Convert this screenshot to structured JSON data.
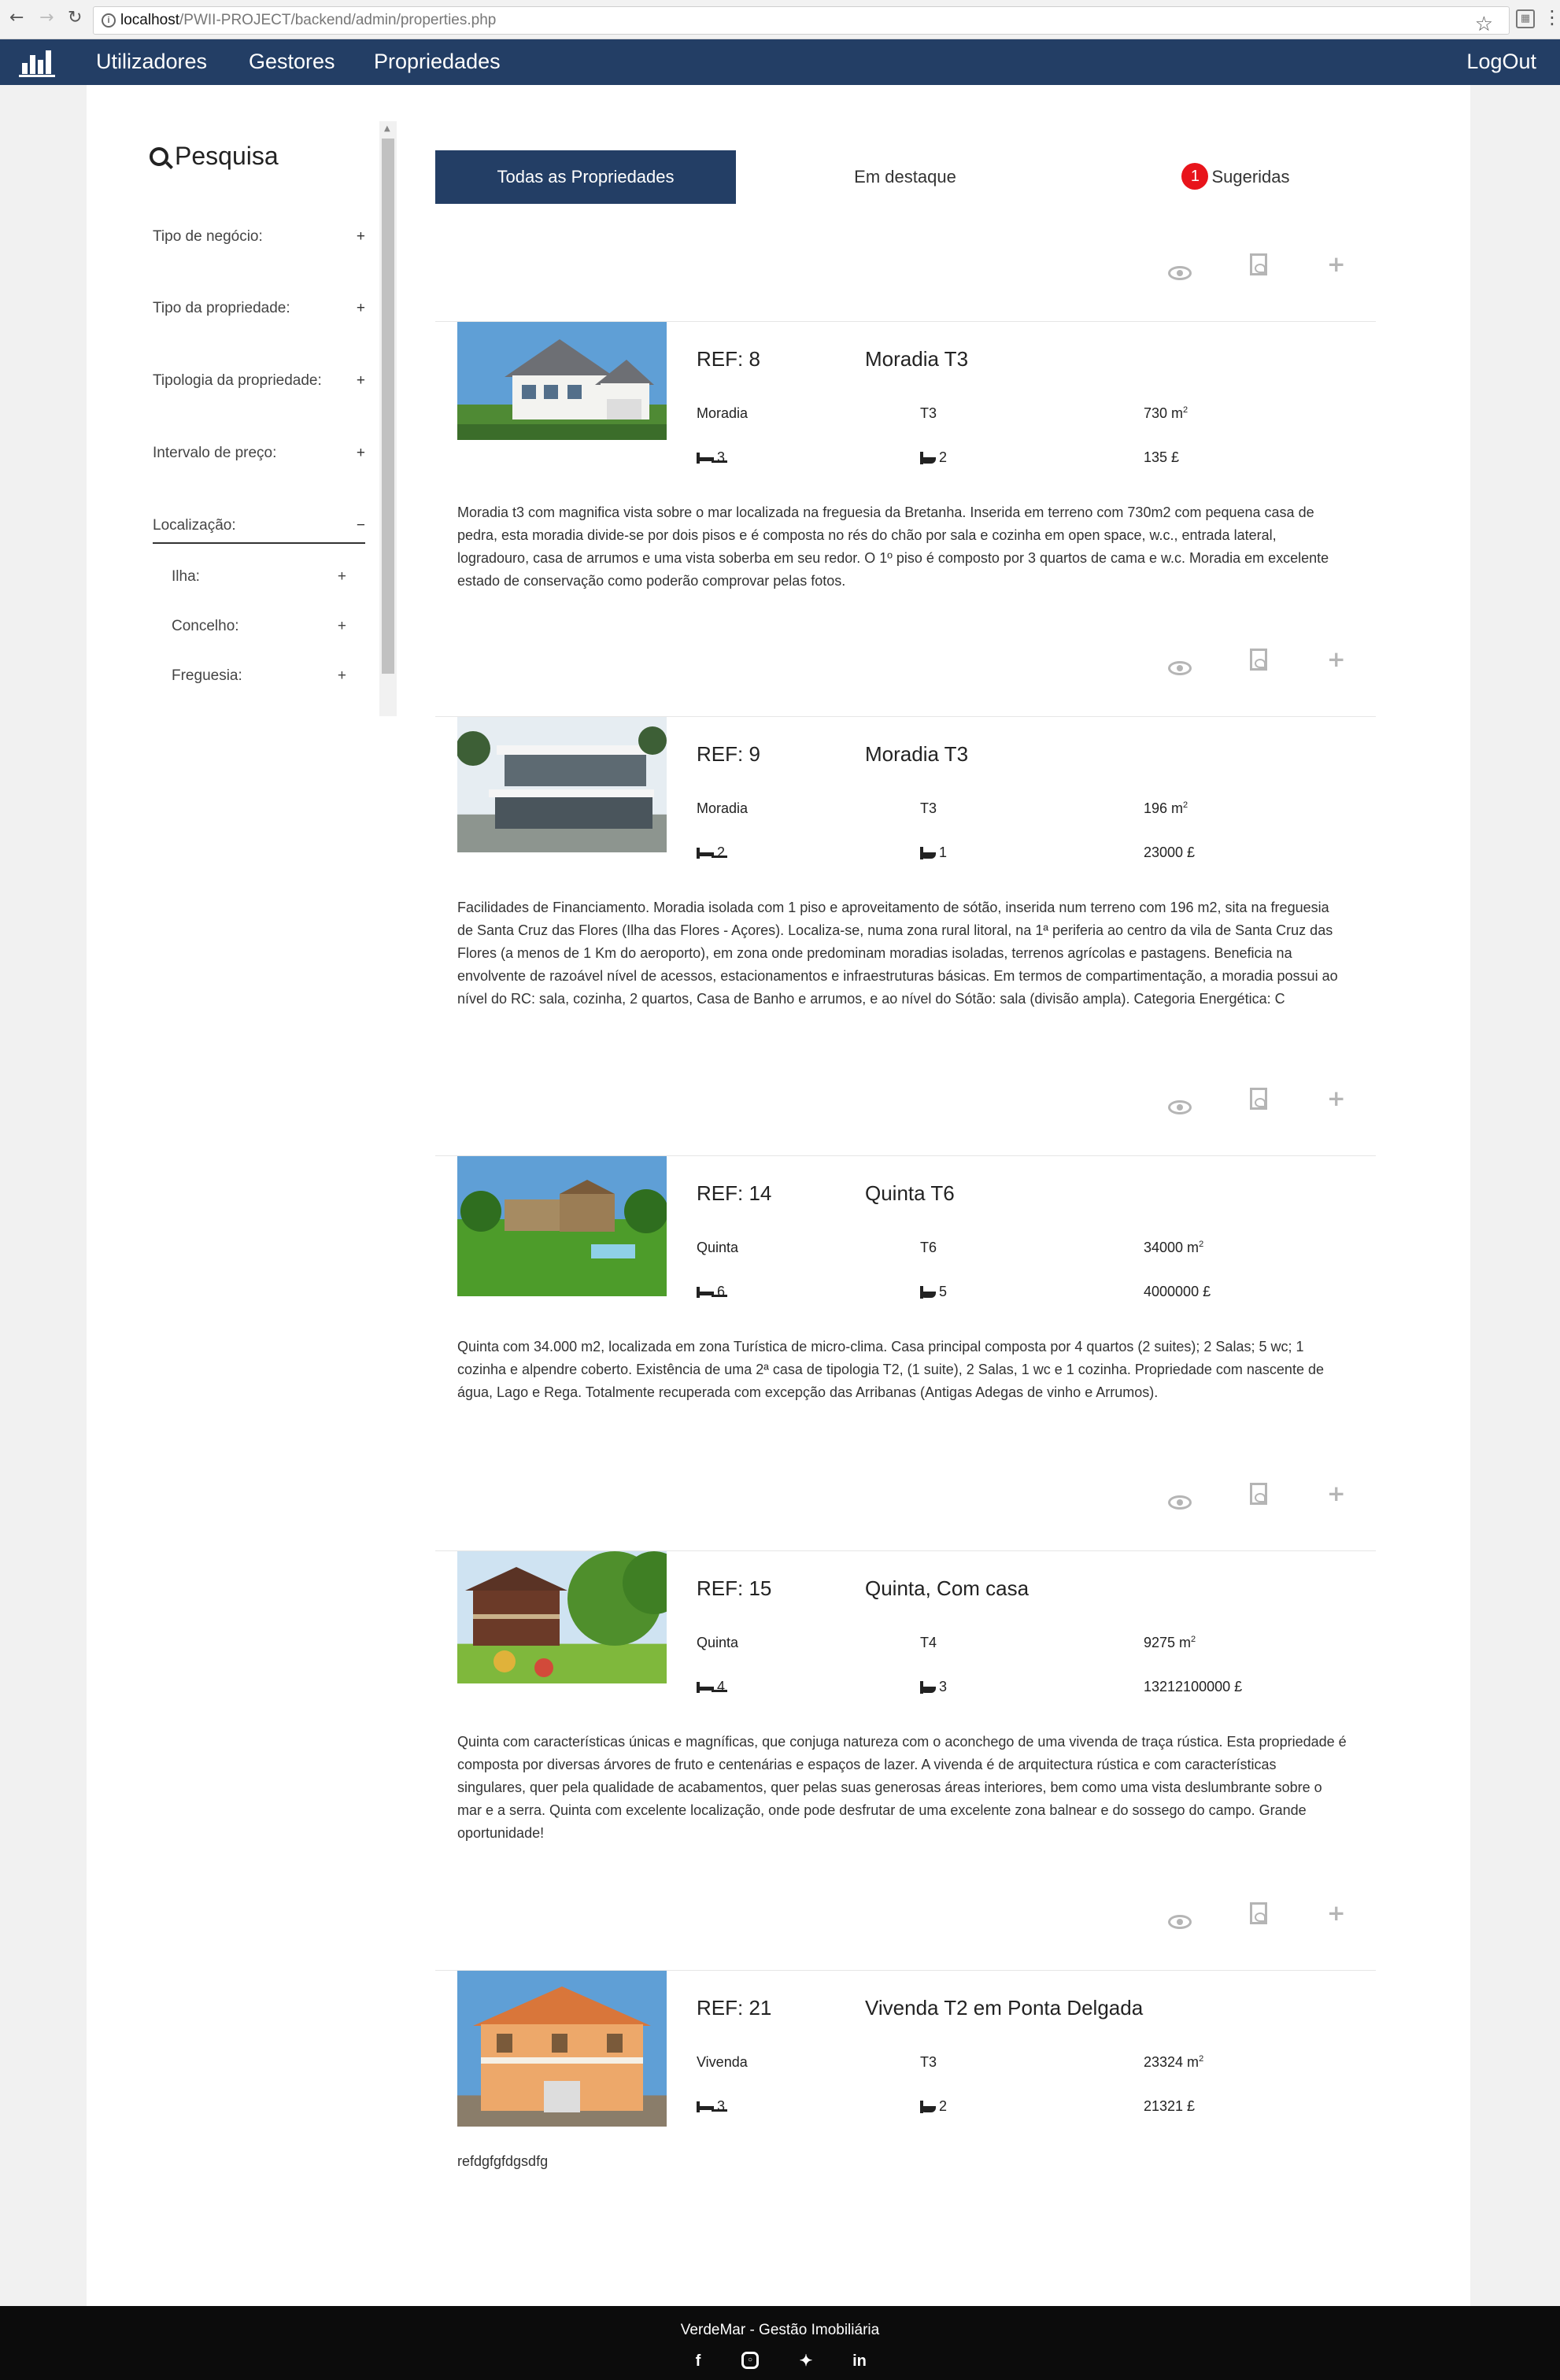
{
  "browser": {
    "url_host": "localhost",
    "url_path": "/PWII-PROJECT/backend/admin/properties.php"
  },
  "navbar": {
    "links": [
      "Utilizadores",
      "Gestores",
      "Propriedades"
    ],
    "logout": "LogOut"
  },
  "sidebar": {
    "title": "Pesquisa",
    "filters": [
      {
        "label": "Tipo de negócio:",
        "sign": "+"
      },
      {
        "label": "Tipo da propriedade:",
        "sign": "+"
      },
      {
        "label": "Tipologia da propriedade:",
        "sign": "+"
      },
      {
        "label": "Intervalo de preço:",
        "sign": "+"
      },
      {
        "label": "Localização:",
        "sign": "−"
      }
    ],
    "location_sub": [
      {
        "label": "Ilha:",
        "sign": "+"
      },
      {
        "label": "Concelho:",
        "sign": "+"
      },
      {
        "label": "Freguesia:",
        "sign": "+"
      }
    ]
  },
  "tabs": {
    "all": "Todas as Propriedades",
    "featured": "Em destaque",
    "suggested": "Sugeridas",
    "suggested_count": "1"
  },
  "properties": [
    {
      "ref": "REF: 8",
      "name": "Moradia T3",
      "type": "Moradia",
      "typology": "T3",
      "area": "730 m",
      "beds": "3",
      "baths": "2",
      "price": "135 £",
      "photo": "house-white",
      "description": "Moradia t3 com magnifica vista sobre o mar localizada na freguesia da Bretanha. Inserida em terreno com 730m2 com pequena casa de pedra, esta moradia divide-se por dois pisos e é composta no rés do chão por sala e cozinha em open space, w.c., entrada lateral, logradouro, casa de arrumos e uma vista soberba em seu redor. O 1º piso é composto por 3 quartos de cama e w.c. Moradia em excelente estado de conservação como poderão comprovar pelas fotos."
    },
    {
      "ref": "REF: 9",
      "name": "Moradia T3",
      "type": "Moradia",
      "typology": "T3",
      "area": "196 m",
      "beds": "2",
      "baths": "1",
      "price": "23000 £",
      "photo": "house-modern",
      "description": "Facilidades de Financiamento. Moradia isolada com 1 piso e aproveitamento de sótão, inserida num terreno com 196 m2, sita na freguesia de Santa Cruz das Flores (Ilha das Flores - Açores). Localiza-se, numa zona rural litoral, na 1ª periferia ao centro da vila de Santa Cruz das Flores (a menos de 1 Km do aeroporto), em zona onde predominam moradias isoladas, terrenos agrícolas e pastagens. Beneficia na envolvente de razoável nível de acessos, estacionamentos e infraestruturas básicas. Em termos de compartimentação, a moradia possui ao nível do RC: sala, cozinha, 2 quartos, Casa de Banho e arrumos, e ao nível do Sótão: sala (divisão ampla). Categoria Energética: C"
    },
    {
      "ref": "REF: 14",
      "name": "Quinta T6",
      "type": "Quinta",
      "typology": "T6",
      "area": "34000 m",
      "beds": "6",
      "baths": "5",
      "price": "4000000 £",
      "photo": "farm-pool",
      "description": "Quinta com 34.000 m2, localizada em zona Turística de micro-clima. Casa principal composta por 4 quartos (2 suites); 2 Salas; 5 wc; 1 cozinha e alpendre coberto. Existência de uma 2ª casa de tipologia T2, (1 suite), 2 Salas, 1 wc e 1 cozinha. Propriedade com nascente de água, Lago e Rega. Totalmente recuperada com excepção das Arribanas (Antigas Adegas de vinho e Arrumos)."
    },
    {
      "ref": "REF: 15",
      "name": "Quinta, Com casa",
      "type": "Quinta",
      "typology": "T4",
      "area": "9275 m",
      "beds": "4",
      "baths": "3",
      "price": "13212100000 £",
      "photo": "farm-wood",
      "description": "Quinta com características únicas e magníficas, que conjuga natureza com o aconchego de uma vivenda de traça rústica. Esta propriedade é composta por diversas árvores de fruto e centenárias e espaços de lazer. A vivenda é de arquitectura rústica e com características singulares, quer pela qualidade de acabamentos, quer pelas suas generosas áreas interiores, bem como uma vista deslumbrante sobre o mar e a serra. Quinta com excelente localização, onde pode desfrutar de uma excelente zona balnear e do sossego do campo. Grande oportunidade!"
    },
    {
      "ref": "REF: 21",
      "name": "Vivenda T2 em Ponta Delgada",
      "type": "Vivenda",
      "typology": "T3",
      "area": "23324 m",
      "beds": "3",
      "baths": "2",
      "price": "21321 £",
      "photo": "villa-orange",
      "description": "refdgfgfdgsdfg"
    }
  ],
  "area_sup": "2",
  "footer": {
    "text": "VerdeMar - Gestão Imobiliária",
    "social": [
      "facebook-icon",
      "instagram-icon",
      "twitter-icon",
      "linkedin-icon"
    ]
  }
}
